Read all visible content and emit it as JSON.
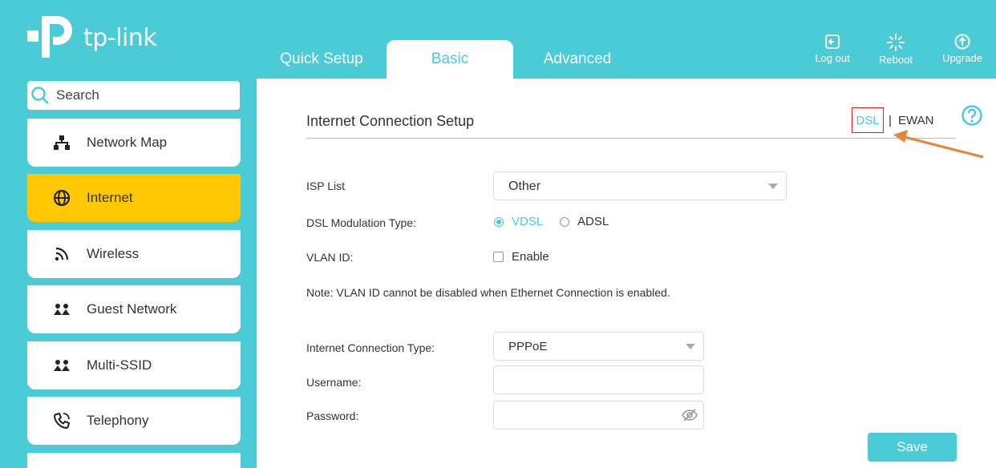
{
  "brand": {
    "logo_text": "tp-link",
    "accent_color": "#4acbd6",
    "active_color": "#ffc800"
  },
  "tabs": [
    {
      "label": "Quick Setup",
      "active": false
    },
    {
      "label": "Basic",
      "active": true
    },
    {
      "label": "Advanced",
      "active": false
    }
  ],
  "toolbar": {
    "logout_label": "Log out",
    "reboot_label": "Reboot",
    "upgrade_label": "Upgrade"
  },
  "sidebar": {
    "search_placeholder": "Search",
    "items": [
      {
        "label": "Network Map",
        "icon": "network-map-icon",
        "active": false
      },
      {
        "label": "Internet",
        "icon": "globe-icon",
        "active": true
      },
      {
        "label": "Wireless",
        "icon": "wireless-icon",
        "active": false
      },
      {
        "label": "Guest Network",
        "icon": "guest-network-icon",
        "active": false
      },
      {
        "label": "Multi-SSID",
        "icon": "multi-ssid-icon",
        "active": false
      },
      {
        "label": "Telephony",
        "icon": "telephony-icon",
        "active": false
      }
    ]
  },
  "main": {
    "section_title": "Internet Connection Setup",
    "mode_switch": {
      "dsl": "DSL",
      "separator": "|",
      "ewan": "EWAN",
      "selected": "DSL"
    },
    "isp_list": {
      "label": "ISP List",
      "value": "Other"
    },
    "dsl_modulation": {
      "label": "DSL Modulation Type:",
      "options": [
        "VDSL",
        "ADSL"
      ],
      "selected": "VDSL"
    },
    "vlan": {
      "label": "VLAN ID:",
      "checkbox_label": "Enable",
      "checked": false
    },
    "note": "Note: VLAN ID cannot be disabled when Ethernet Connection is enabled.",
    "connection_type": {
      "label": "Internet Connection Type:",
      "value": "PPPoE"
    },
    "username": {
      "label": "Username:",
      "value": ""
    },
    "password": {
      "label": "Password:",
      "value": ""
    },
    "save_label": "Save"
  }
}
